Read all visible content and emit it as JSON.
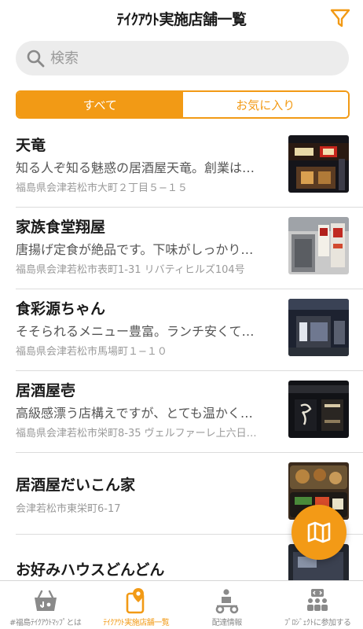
{
  "header": {
    "title": "ﾃｲｸｱｳﾄ実施店舗一覧",
    "filter_icon": "filter-icon"
  },
  "search": {
    "placeholder": "検索",
    "value": "",
    "icon": "search-icon"
  },
  "segment": {
    "all_label": "すべて",
    "favorites_label": "お気に入り",
    "selected": "all"
  },
  "colors": {
    "accent": "#f29a15",
    "text": "#1a1a1a",
    "muted": "#9a9a9a"
  },
  "restaurants": [
    {
      "name": "天竜",
      "description": "知る人ぞ知る魅惑の居酒屋天竜。創業は…",
      "address": "福島県会津若松市大町２丁目５−１５"
    },
    {
      "name": "家族食堂翔屋",
      "description": "唐揚げ定食が絶品です。下味がしっかり…",
      "address": "福島県会津若松市表町1-31 リバティヒルズ104号"
    },
    {
      "name": "食彩源ちゃん",
      "description": "そそられるメニュー豊富。ランチ安くて…",
      "address": "福島県会津若松市馬場町１−１０"
    },
    {
      "name": "居酒屋壱",
      "description": "高級感漂う店構えですが、とても温かく…",
      "address": "福島県会津若松市栄町8-35 ヴェルファーレ上六日…"
    },
    {
      "name": "居酒屋だいこん家",
      "description": "",
      "address": "会津若松市東栄町6-17"
    },
    {
      "name": "お好みハウスどんどん",
      "description": "",
      "address": ""
    }
  ],
  "fab": {
    "icon": "map-icon"
  },
  "tabs": [
    {
      "label": "#福島ﾃｲｸｱｳﾄﾏｯﾌﾟとは",
      "icon": "basket-icon",
      "active": false
    },
    {
      "label": "ﾃｲｸｱｳﾄ実施店舗一覧",
      "icon": "phone-location-icon",
      "active": true
    },
    {
      "label": "配達情報",
      "icon": "delivery-scooter-icon",
      "active": false
    },
    {
      "label": "ﾌﾟﾛｼﾞｪｸﾄに参加する",
      "icon": "team-icon",
      "active": false
    }
  ]
}
